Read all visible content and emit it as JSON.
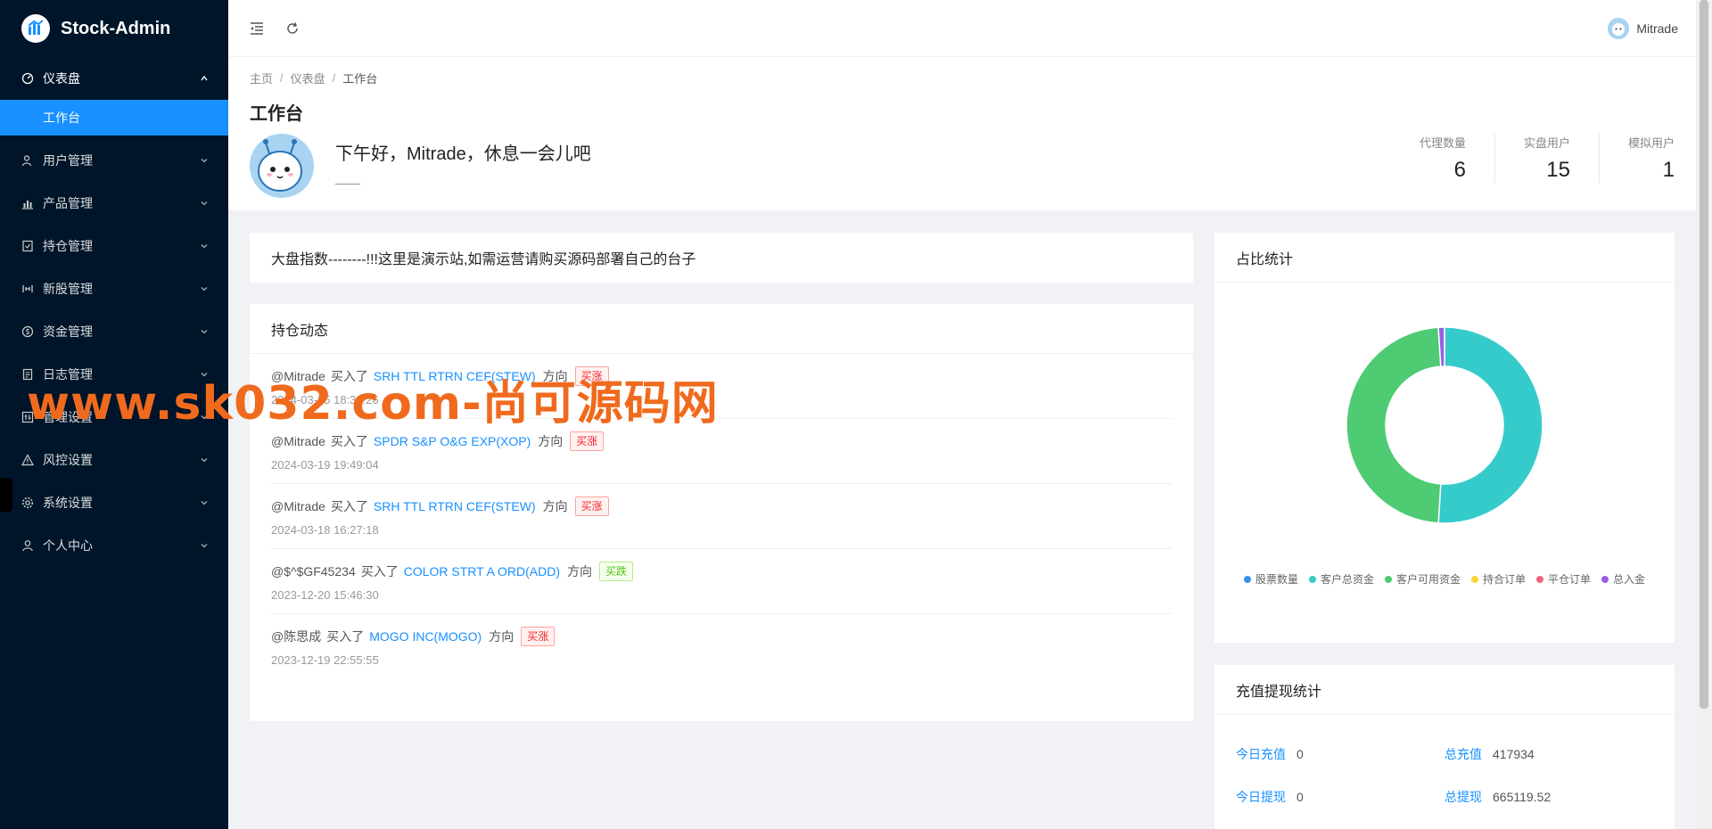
{
  "app": {
    "title": "Stock-Admin"
  },
  "sidebar": {
    "items": [
      {
        "label": "仪表盘",
        "icon": "dashboard-icon",
        "open": true,
        "children": [
          {
            "label": "工作台"
          }
        ]
      },
      {
        "label": "用户管理",
        "icon": "user-manage-icon"
      },
      {
        "label": "产品管理",
        "icon": "chart-bar-icon"
      },
      {
        "label": "持仓管理",
        "icon": "position-icon"
      },
      {
        "label": "新股管理",
        "icon": "new-stock-icon"
      },
      {
        "label": "资金管理",
        "icon": "money-icon"
      },
      {
        "label": "日志管理",
        "icon": "log-icon"
      },
      {
        "label": "管理设置",
        "icon": "admin-settings-icon"
      },
      {
        "label": "风控设置",
        "icon": "warning-icon"
      },
      {
        "label": "系统设置",
        "icon": "gear-icon"
      },
      {
        "label": "个人中心",
        "icon": "person-icon"
      }
    ]
  },
  "header": {
    "user_name": "Mitrade"
  },
  "breadcrumb": [
    "主页",
    "仪表盘",
    "工作台"
  ],
  "page": {
    "title": "工作台",
    "greeting": "下午好，Mitrade，休息一会儿吧",
    "subline": "——",
    "stats": [
      {
        "label": "代理数量",
        "value": "6"
      },
      {
        "label": "实盘用户",
        "value": "15"
      },
      {
        "label": "模拟用户",
        "value": "1"
      }
    ]
  },
  "index_card": {
    "text": "大盘指数--------!!!这里是演示站,如需运营请购买源码部署自己的台子"
  },
  "positions": {
    "title": "持仓动态",
    "items": [
      {
        "user": "@Mitrade",
        "action": "买入了",
        "stock": "SRH TTL RTRN CEF(STEW)",
        "dir": "方向",
        "tag": "买涨",
        "tag_type": "rise",
        "time": "2024-03-25 18:32:26"
      },
      {
        "user": "@Mitrade",
        "action": "买入了",
        "stock": "SPDR S&P O&G EXP(XOP)",
        "dir": "方向",
        "tag": "买涨",
        "tag_type": "rise",
        "time": "2024-03-19 19:49:04"
      },
      {
        "user": "@Mitrade",
        "action": "买入了",
        "stock": "SRH TTL RTRN CEF(STEW)",
        "dir": "方向",
        "tag": "买涨",
        "tag_type": "rise",
        "time": "2024-03-18 16:27:18"
      },
      {
        "user": "@$^$GF45234",
        "action": "买入了",
        "stock": "COLOR STRT A ORD(ADD)",
        "dir": "方向",
        "tag": "买跌",
        "tag_type": "fall",
        "time": "2023-12-20 15:46:30"
      },
      {
        "user": "@陈思成",
        "action": "买入了",
        "stock": "MOGO INC(MOGO)",
        "dir": "方向",
        "tag": "买涨",
        "tag_type": "rise",
        "time": "2023-12-19 22:55:55"
      }
    ]
  },
  "ratio_card": {
    "title": "占比统计"
  },
  "chart_data": {
    "type": "pie",
    "title": "",
    "series": [
      {
        "name": "股票数量",
        "value": 0,
        "color": "#3a8ee6"
      },
      {
        "name": "客户总资金",
        "value": 51,
        "color": "#36cbcb"
      },
      {
        "name": "客户可用资金",
        "value": 48,
        "color": "#4ecb73"
      },
      {
        "name": "持合订单",
        "value": 0,
        "color": "#fbd437"
      },
      {
        "name": "平仓订单",
        "value": 0,
        "color": "#f2637b"
      },
      {
        "name": "总入金",
        "value": 1,
        "color": "#975fe5"
      }
    ]
  },
  "recharge": {
    "title": "充值提现统计",
    "rows": [
      {
        "l_label": "今日充值",
        "l_value": "0",
        "r_label": "总充值",
        "r_value": "417934"
      },
      {
        "l_label": "今日提现",
        "l_value": "0",
        "r_label": "总提现",
        "r_value": "665119.52"
      }
    ]
  },
  "watermark": {
    "text": "www.sk032.com-尚可源码网"
  },
  "colors": {
    "sidebar_bg": "#001529",
    "accent": "#1890ff",
    "rise": "#f5222d",
    "fall": "#52c41a"
  }
}
